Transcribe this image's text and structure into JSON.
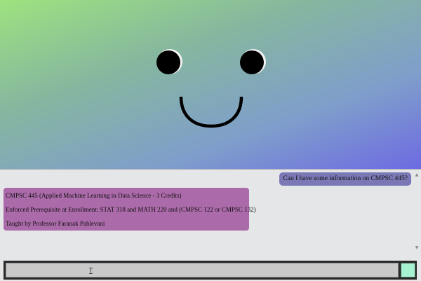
{
  "chat": {
    "user_message": "Can I have some information on CMPSC 445?",
    "bot_response": {
      "lines": [
        "CMPSC 445 (Applied Machine Learning in Data Science - 3 Credits)",
        "Enforced Prerequisite at Enrollment: STAT 318 and MATH 220 and (CMPSC 122 or CMPSC 132)",
        "Taught by Professor Faranak Pahlevani"
      ]
    }
  },
  "icons": {
    "scroll_up": "▲",
    "scroll_down": "▼",
    "text_cursor": "i-beam-cursor-icon"
  },
  "colors": {
    "gradient_start": "#9ee27f",
    "gradient_end": "#6d6be2",
    "user_bubble": "#7a79b6",
    "bot_bubble": "#ab6aa9",
    "send_button": "#a6f3d2"
  }
}
